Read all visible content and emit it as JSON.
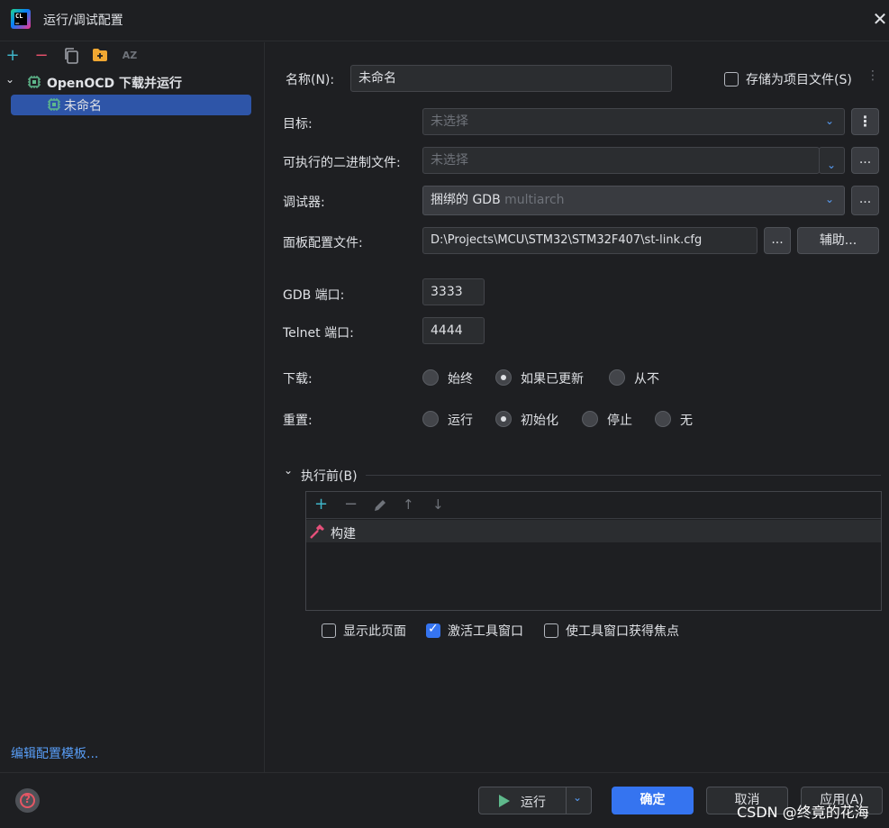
{
  "window": {
    "title": "运行/调试配置",
    "close": "✕"
  },
  "left": {
    "toolbar": [
      "+",
      "−",
      "copy",
      "folder",
      "AZ"
    ],
    "tree": {
      "parent": "OpenOCD 下载并运行",
      "child": "未命名"
    },
    "edit_templates": "编辑配置模板..."
  },
  "form": {
    "name_label": "名称(N):",
    "name_value": "未命名",
    "store_label": "存储为项目文件(S)",
    "target_label": "目标:",
    "target_value": "未选择",
    "binary_label": "可执行的二进制文件:",
    "binary_value": "未选择",
    "debugger_label": "调试器:",
    "debugger_value": "捆绑的 GDB",
    "debugger_suffix": "multiarch",
    "board_label": "面板配置文件:",
    "board_value": "D:\\Projects\\MCU\\STM32\\STM32F407\\st-link.cfg",
    "assist_button": "辅助...",
    "ellipsis": "...",
    "gdb_port_label": "GDB 端口:",
    "gdb_port_value": "3333",
    "telnet_port_label": "Telnet 端口:",
    "telnet_port_value": "4444",
    "download_label": "下载:",
    "download_options": [
      "始终",
      "如果已更新",
      "从不"
    ],
    "download_selected": 1,
    "reset_label": "重置:",
    "reset_options": [
      "运行",
      "初始化",
      "停止",
      "无"
    ],
    "reset_selected": 1,
    "before_launch_label": "执行前(B)",
    "before_launch_items": [
      "构建"
    ],
    "show_page_label": "显示此页面",
    "activate_window_label": "激活工具窗口",
    "focus_window_label": "使工具窗口获得焦点"
  },
  "bottom": {
    "run_button": "运行",
    "ok_button": "确定",
    "cancel_button": "取消",
    "apply_button": "应用(A)",
    "help": "?"
  },
  "watermark": "CSDN @终竟的花海",
  "colors": {
    "accent": "#3574f0",
    "selection": "#2e55a8",
    "link": "#589df6",
    "hammer": "#e5507a"
  }
}
